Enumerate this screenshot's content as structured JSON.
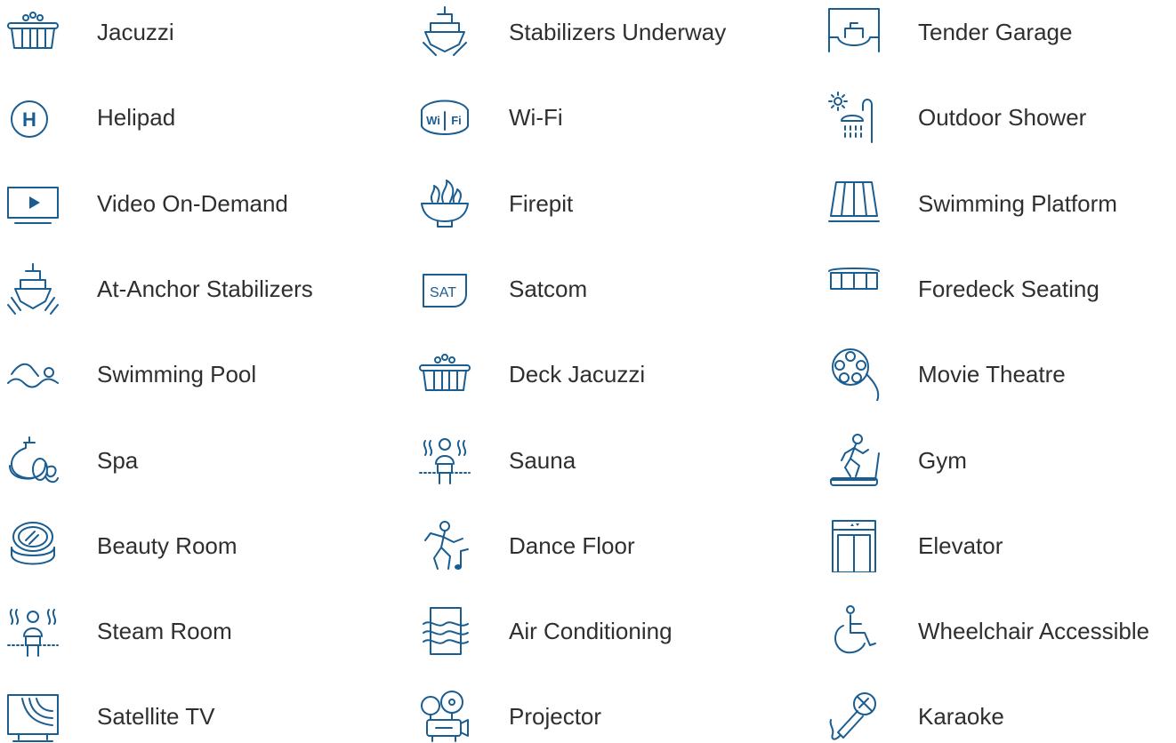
{
  "brand_color": "#1a5d91",
  "text_color": "#2f2f2f",
  "columns": [
    [
      {
        "label": "Jacuzzi",
        "icon": "jacuzzi-icon"
      },
      {
        "label": "Helipad",
        "icon": "helipad-icon"
      },
      {
        "label": "Video On-Demand",
        "icon": "video-on-demand-icon"
      },
      {
        "label": "At-Anchor Stabilizers",
        "icon": "at-anchor-stabilizers-icon"
      },
      {
        "label": "Swimming Pool",
        "icon": "swimming-pool-icon"
      },
      {
        "label": "Spa",
        "icon": "spa-icon"
      },
      {
        "label": "Beauty Room",
        "icon": "beauty-room-icon"
      },
      {
        "label": "Steam Room",
        "icon": "steam-room-icon"
      },
      {
        "label": "Satellite TV",
        "icon": "satellite-tv-icon"
      }
    ],
    [
      {
        "label": "Stabilizers Underway",
        "icon": "stabilizers-underway-icon"
      },
      {
        "label": "Wi-Fi",
        "icon": "wifi-icon",
        "icon_text": [
          "Wi",
          "Fi"
        ]
      },
      {
        "label": "Firepit",
        "icon": "firepit-icon"
      },
      {
        "label": "Satcom",
        "icon": "satcom-icon",
        "icon_text": [
          "SAT"
        ]
      },
      {
        "label": "Deck Jacuzzi",
        "icon": "deck-jacuzzi-icon"
      },
      {
        "label": "Sauna",
        "icon": "sauna-icon"
      },
      {
        "label": "Dance Floor",
        "icon": "dance-floor-icon"
      },
      {
        "label": "Air Conditioning",
        "icon": "air-conditioning-icon"
      },
      {
        "label": "Projector",
        "icon": "projector-icon"
      }
    ],
    [
      {
        "label": "Tender Garage",
        "icon": "tender-garage-icon"
      },
      {
        "label": "Outdoor Shower",
        "icon": "outdoor-shower-icon"
      },
      {
        "label": "Swimming Platform",
        "icon": "swimming-platform-icon"
      },
      {
        "label": "Foredeck Seating",
        "icon": "foredeck-seating-icon"
      },
      {
        "label": "Movie Theatre",
        "icon": "movie-theatre-icon"
      },
      {
        "label": "Gym",
        "icon": "gym-icon"
      },
      {
        "label": "Elevator",
        "icon": "elevator-icon"
      },
      {
        "label": "Wheelchair Accessible",
        "icon": "wheelchair-accessible-icon"
      },
      {
        "label": "Karaoke",
        "icon": "karaoke-icon"
      }
    ]
  ]
}
